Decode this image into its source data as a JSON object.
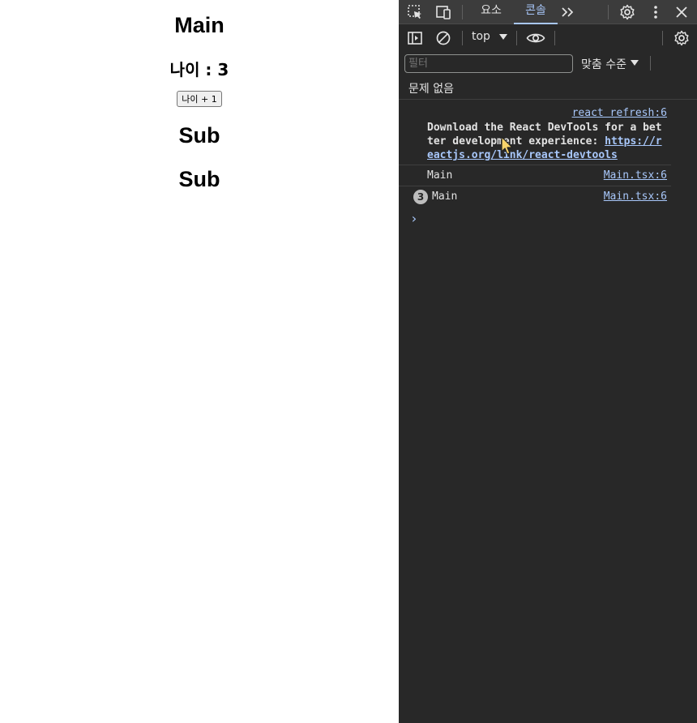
{
  "app": {
    "title": "Main",
    "age_text": "나이 : 3",
    "age_button": "나이 + 1",
    "subs": [
      "Sub",
      "Sub"
    ]
  },
  "devtools": {
    "tabs": [
      {
        "label": "요소",
        "active": false
      },
      {
        "label": "콘솔",
        "active": true
      }
    ],
    "context": "top",
    "filter_placeholder": "필터",
    "levels": "맞춤 수준",
    "issues": "문제 없음",
    "messages": {
      "devtools_source": "react refresh:6",
      "devtools_text": "Download the React DevTools for a better development experience: ",
      "devtools_link": "https://reactjs.org/link/react-devtools",
      "log1_text": "Main",
      "log1_source": "Main.tsx:6",
      "log2_count": "3",
      "log2_text": "Main",
      "log2_source": "Main.tsx:6"
    },
    "prompt_symbol": "›"
  },
  "colors": {
    "devtools_bg": "#282828",
    "tabbar_bg": "#3c3c3c",
    "accent": "#a8c7fa",
    "text": "#e3e3e3"
  },
  "icons": [
    "inspect-element-icon",
    "device-toolbar-icon",
    "more-tabs-icon",
    "settings-icon",
    "kebab-menu-icon",
    "close-icon",
    "sidebar-toggle-icon",
    "clear-console-icon",
    "live-expression-eye-icon",
    "console-settings-icon",
    "mouse-cursor-icon"
  ]
}
